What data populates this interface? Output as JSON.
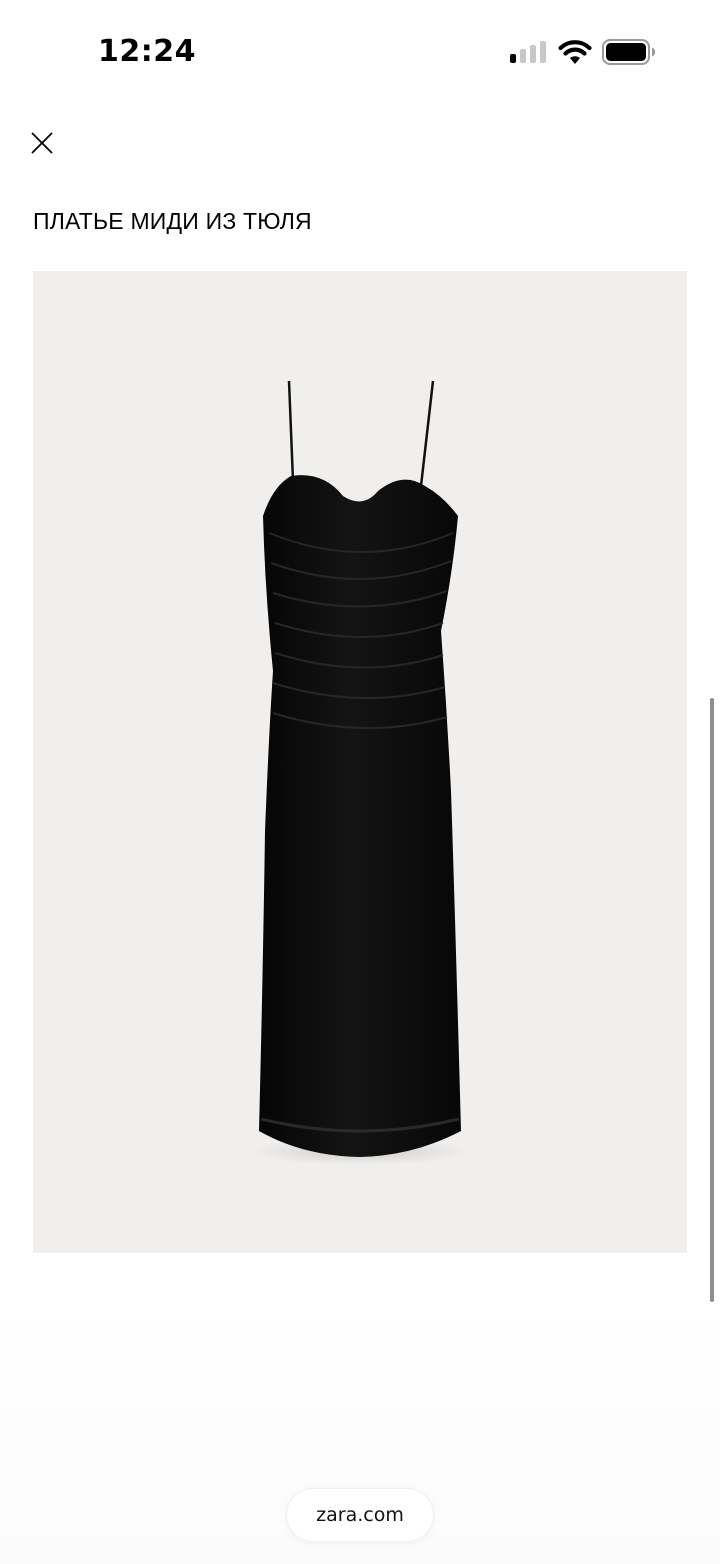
{
  "status_bar": {
    "time": "12:24",
    "signal_icon": "cellular-signal-icon",
    "wifi_icon": "wifi-icon",
    "battery_icon": "battery-icon"
  },
  "header": {
    "close_icon": "close-icon"
  },
  "product": {
    "title": "ПЛАТЬЕ МИДИ ИЗ ТЮЛЯ",
    "image_background": "#f0efed",
    "dress_color": "#0d0d0d"
  },
  "browser": {
    "url": "zara.com"
  }
}
